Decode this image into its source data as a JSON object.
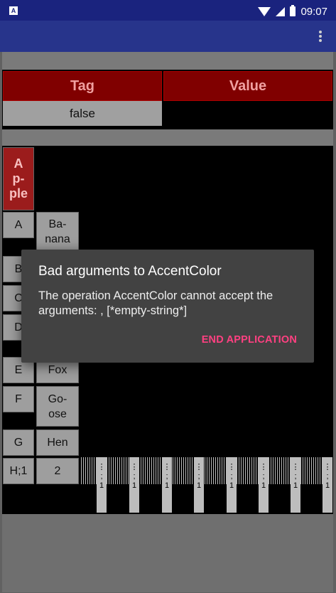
{
  "status_bar": {
    "time": "09:07",
    "notification_icon": "A"
  },
  "table": {
    "header_tag": "Tag",
    "header_value": "Value",
    "row_value": "false"
  },
  "grid": {
    "cells": {
      "apple": "A\np-\nple",
      "a": "A",
      "banana": "Ba-\nnana",
      "b": "B",
      "c": "C",
      "d": "D",
      "e": "E",
      "fox": "Fox",
      "f": "F",
      "goose": "Go-\nose",
      "g": "G",
      "hen": "Hen",
      "h1": "H;1",
      "two": "2"
    },
    "small_label": "⋮\n;\n1"
  },
  "dialog": {
    "title": "Bad arguments to AccentColor",
    "message": "The operation AccentColor cannot accept the arguments: , [*empty-string*]",
    "button": "END APPLICATION"
  },
  "colors": {
    "status_bar": "#1a237e",
    "app_bar": "#27348b",
    "header_red": "#800000",
    "dialog_bg": "#424242",
    "dialog_button": "#ff4081"
  }
}
